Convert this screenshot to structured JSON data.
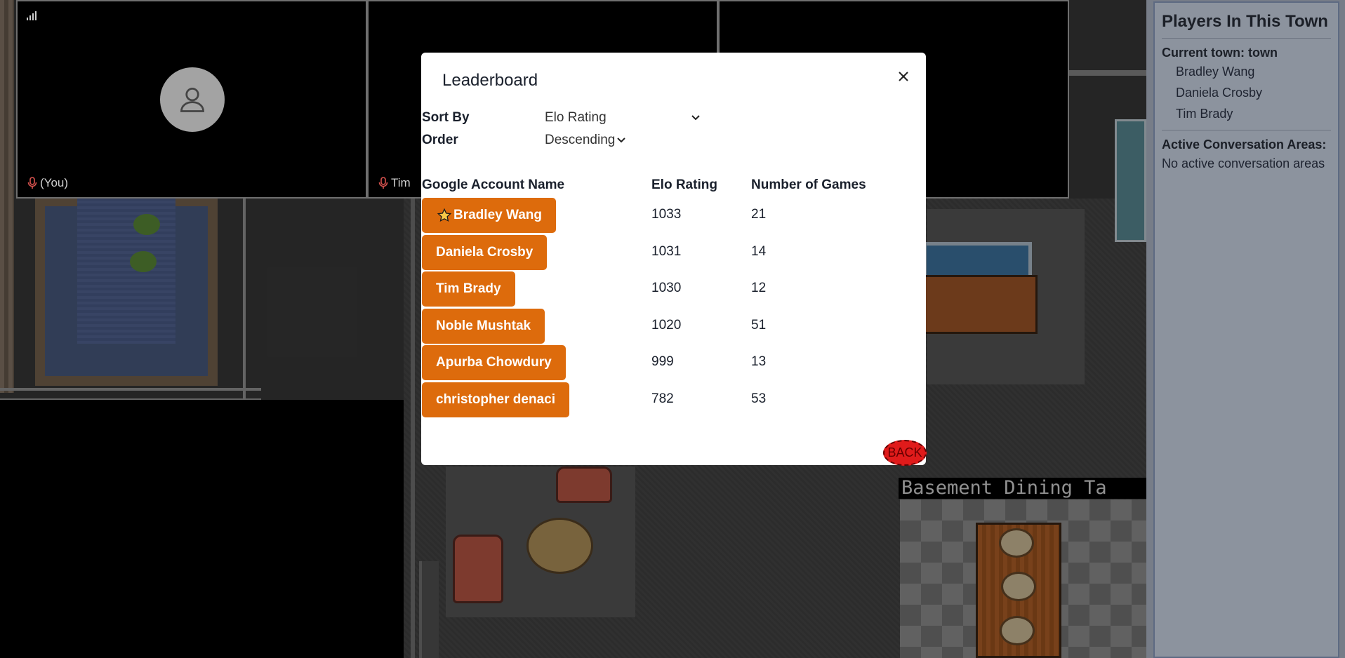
{
  "video_tiles": [
    {
      "label": "(You)"
    },
    {
      "label": "Tim"
    },
    {
      "label": ""
    }
  ],
  "map": {
    "area_label": "Basement Dining Ta"
  },
  "sidebar": {
    "title": "Players In This Town",
    "current_town_label": "Current town: town",
    "players": [
      "Bradley Wang",
      "Daniela Crosby",
      "Tim Brady"
    ],
    "conversation_heading": "Active Conversation Areas:",
    "conversation_empty": "No active conversation areas"
  },
  "modal": {
    "title": "Leaderboard",
    "sort_by_label": "Sort By",
    "sort_by_value": "Elo Rating",
    "order_label": "Order",
    "order_value": "Descending",
    "columns": [
      "Google Account Name",
      "Elo Rating",
      "Number of Games"
    ],
    "rows": [
      {
        "name": "Bradley Wang",
        "elo": "1033",
        "games": "21",
        "starred": true
      },
      {
        "name": "Daniela Crosby",
        "elo": "1031",
        "games": "14",
        "starred": false
      },
      {
        "name": "Tim Brady",
        "elo": "1030",
        "games": "12",
        "starred": false
      },
      {
        "name": "Noble Mushtak",
        "elo": "1020",
        "games": "51",
        "starred": false
      },
      {
        "name": "Apurba Chowdury",
        "elo": "999",
        "games": "13",
        "starred": false
      },
      {
        "name": "christopher denaci",
        "elo": "782",
        "games": "53",
        "starred": false
      }
    ],
    "back_label": "BACK"
  },
  "colors": {
    "accent": "#dd6b0c",
    "back_button": "#e01b1b"
  }
}
